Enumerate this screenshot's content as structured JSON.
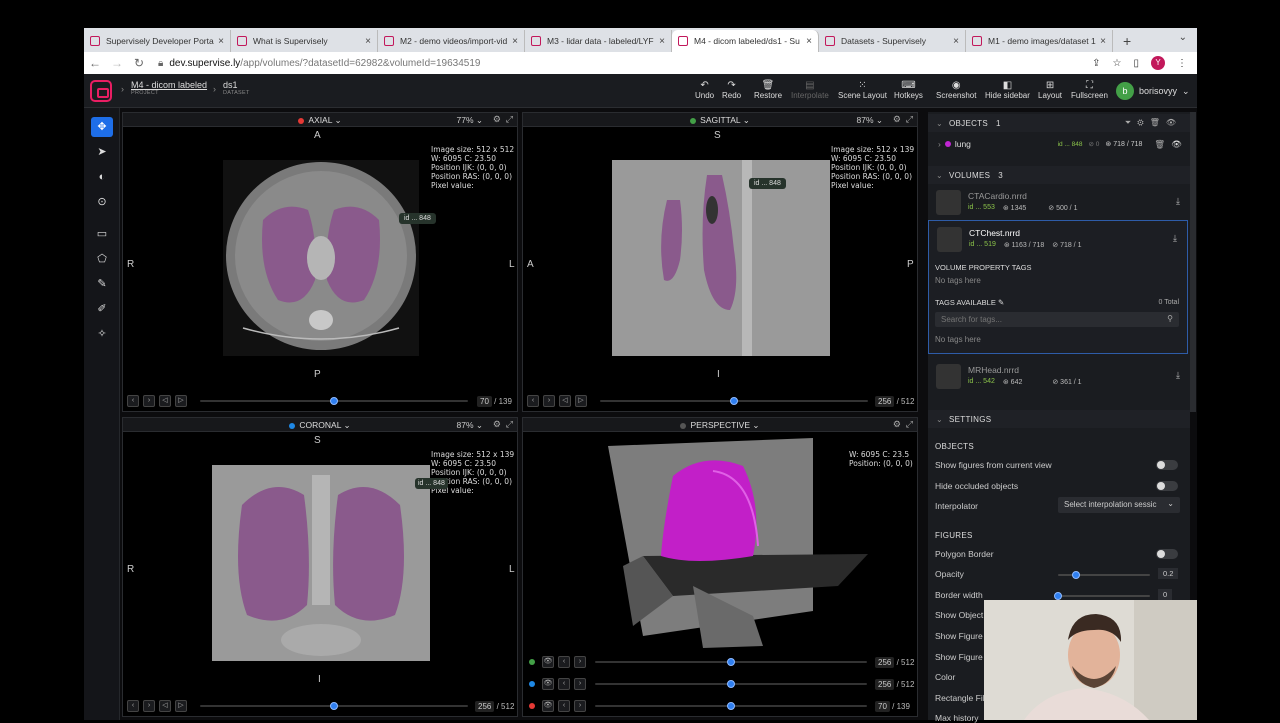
{
  "browser": {
    "tabs": [
      {
        "title": "Supervisely Developer Portal",
        "active": false
      },
      {
        "title": "What is Supervisely",
        "active": false
      },
      {
        "title": "M2 - demo videos/import-vid",
        "active": false
      },
      {
        "title": "M3 - lidar data - labeled/LYF",
        "active": false
      },
      {
        "title": "M4 - dicom labeled/ds1 - Su",
        "active": true
      },
      {
        "title": "Datasets - Supervisely",
        "active": false
      },
      {
        "title": "M1 - demo images/dataset 1",
        "active": false
      }
    ],
    "new_tab": "+",
    "url_host": "dev.supervise.ly",
    "url_path": "/app/volumes/?datasetId=62982&volumeId=19634519",
    "profile_letter": "Y"
  },
  "breadcrumb": {
    "project": "M4 - dicom labeled",
    "project_sub": "PROJECT",
    "dataset": "ds1",
    "dataset_sub": "DATASET"
  },
  "topbar": {
    "undo": "Undo",
    "redo": "Redo",
    "restore": "Restore",
    "interpolate": "Interpolate",
    "scene_layout": "Scene Layout",
    "hotkeys": "Hotkeys",
    "screenshot": "Screenshot",
    "hide_sidebar": "Hide sidebar",
    "layout": "Layout",
    "fullscreen": "Fullscreen",
    "user_initial": "b",
    "user_name": "borisovyy"
  },
  "viewports": {
    "axial": {
      "title": "AXIAL",
      "zoom": "77%",
      "top": "A",
      "bottom": "P",
      "left": "R",
      "right": "L",
      "slice": "70",
      "total": "/ 139",
      "slice_fraction": 0.5,
      "dot": "#e53935",
      "info": [
        "Image size: 512 x 512",
        "W: 6095 C: 23.50",
        "Position IJK: (0, 0, 0)",
        "Position RAS: (0, 0, 0)",
        "Pixel value:"
      ],
      "id_tag": "id ... 848"
    },
    "sagittal": {
      "title": "SAGITTAL",
      "zoom": "87%",
      "top": "S",
      "bottom": "I",
      "left": "A",
      "right": "P",
      "slice": "256",
      "total": "/ 512",
      "slice_fraction": 0.5,
      "dot": "#43a047",
      "info": [
        "Image size: 512 x 139",
        "W: 6095 C: 23.50",
        "Position IJK: (0, 0, 0)",
        "Position RAS: (0, 0, 0)",
        "Pixel value:"
      ],
      "id_tag": "id ... 848"
    },
    "coronal": {
      "title": "CORONAL",
      "zoom": "87%",
      "top": "S",
      "bottom": "I",
      "left": "R",
      "right": "L",
      "slice": "256",
      "total": "/ 512",
      "slice_fraction": 0.5,
      "dot": "#1e88e5",
      "info": [
        "Image size: 512 x 139",
        "W: 6095 C: 23.50",
        "Position IJK: (0, 0, 0)",
        "Position RAS: (0, 0, 0)",
        "Pixel value:"
      ],
      "id_tag": "id ... 848"
    },
    "perspective": {
      "title": "PERSPECTIVE",
      "info": [
        "W: 6095 C: 23.5",
        "Position: (0, 0, 0)"
      ],
      "rows": [
        {
          "color": "#43a047",
          "slice": "256",
          "total": "/ 512",
          "fraction": 0.5
        },
        {
          "color": "#1e88e5",
          "slice": "256",
          "total": "/ 512",
          "fraction": 0.5
        },
        {
          "color": "#e53935",
          "slice": "70",
          "total": "/ 139",
          "fraction": 0.5
        }
      ]
    }
  },
  "sidebar": {
    "objects_label": "OBJECTS",
    "objects_count": "1",
    "object": {
      "name": "lung",
      "id": "id ... 848",
      "figures": "0",
      "stats": "718 / 718",
      "color": "#c026d3"
    },
    "volumes_label": "VOLUMES",
    "volumes_count": "3",
    "volumes": [
      {
        "name": "CTACardio.nrrd",
        "id": "id ... 553",
        "figures": "1345",
        "slices": "500 / 1"
      },
      {
        "name": "CTChest.nrrd",
        "id": "id ... 519",
        "figures": "1163 / 718",
        "slices": "718 / 1"
      },
      {
        "name": "MRHead.nrrd",
        "id": "id ... 542",
        "figures": "642",
        "slices": "361 / 1"
      }
    ],
    "vol_tags_label": "VOLUME PROPERTY TAGS",
    "no_tags": "No tags here",
    "tags_avail_label": "TAGS AVAILABLE",
    "tags_total": "0 Total",
    "search_placeholder": "Search for tags...",
    "no_tags2": "No tags here",
    "settings_label": "SETTINGS",
    "objects_section": "OBJECTS",
    "show_figures": "Show figures from current view",
    "hide_occluded": "Hide occluded objects",
    "interpolator": "Interpolator",
    "interp_select": "Select interpolation sessic",
    "figures_section": "FIGURES",
    "polygon_border": "Polygon Border",
    "opacity": "Opacity",
    "opacity_val": "0.2",
    "opacity_fraction": 0.2,
    "border_width": "Border width",
    "border_val": "0",
    "border_fraction": 0,
    "show_object": "Show Object",
    "show_figure1": "Show Figure",
    "show_figure2": "Show Figure",
    "color": "Color",
    "rectangle_fill": "Rectangle Fill",
    "max_history": "Max history"
  }
}
